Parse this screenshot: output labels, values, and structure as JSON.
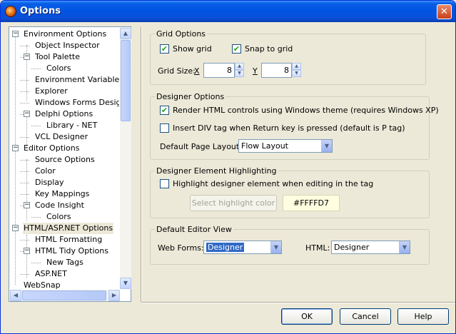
{
  "window": {
    "title": "Options",
    "close_glyph": "✕"
  },
  "tree": {
    "items": [
      {
        "label": "Environment Options",
        "expander": "−"
      },
      {
        "label": "Object Inspector"
      },
      {
        "label": "Tool Palette",
        "expander": "−"
      },
      {
        "label": "Colors"
      },
      {
        "label": "Environment Variables"
      },
      {
        "label": "Explorer"
      },
      {
        "label": "Windows Forms Designer"
      },
      {
        "label": "Delphi Options",
        "expander": "−"
      },
      {
        "label": "Library - NET"
      },
      {
        "label": "VCL Designer"
      },
      {
        "label": "Editor Options",
        "expander": "−"
      },
      {
        "label": "Source Options"
      },
      {
        "label": "Color"
      },
      {
        "label": "Display"
      },
      {
        "label": "Key Mappings"
      },
      {
        "label": "Code Insight",
        "expander": "−"
      },
      {
        "label": "Colors"
      },
      {
        "label": "HTML/ASP.NET Options",
        "expander": "−",
        "selected": true
      },
      {
        "label": "HTML Formatting"
      },
      {
        "label": "HTML Tidy Options",
        "expander": "−"
      },
      {
        "label": "New Tags"
      },
      {
        "label": "ASP.NET"
      },
      {
        "label": "WebSnap"
      }
    ]
  },
  "grid_options": {
    "title": "Grid Options",
    "show_grid": {
      "label": "Show grid",
      "checked": true
    },
    "snap_to_grid": {
      "label": "Snap to grid",
      "checked": true
    },
    "grid_size_label": "Grid Size:",
    "x_label": "X",
    "x_value": "8",
    "y_label": "Y",
    "y_value": "8"
  },
  "designer_options": {
    "title": "Designer Options",
    "render_html": {
      "label": "Render HTML controls using Windows theme (requires Windows XP)",
      "checked": true
    },
    "insert_div": {
      "label": "Insert DIV tag when Return key is pressed (default is P tag)",
      "checked": false
    },
    "page_layout_label": "Default Page Layout:",
    "page_layout_value": "Flow Layout"
  },
  "highlighting": {
    "title": "Designer Element Highlighting",
    "highlight": {
      "label": "Highlight designer element when editing in the tag",
      "checked": false
    },
    "select_color_label": "Select highlight color",
    "color_value": "#FFFFD7"
  },
  "editor_view": {
    "title": "Default Editor View",
    "web_forms_label": "Web Forms:",
    "web_forms_value": "Designer",
    "html_label": "HTML:",
    "html_value": "Designer"
  },
  "buttons": {
    "ok": "OK",
    "cancel": "Cancel",
    "help": "Help"
  },
  "colors": {
    "titlebar": "#0054e3",
    "dialog_bg": "#ece9d8",
    "selection": "#316ac5"
  }
}
